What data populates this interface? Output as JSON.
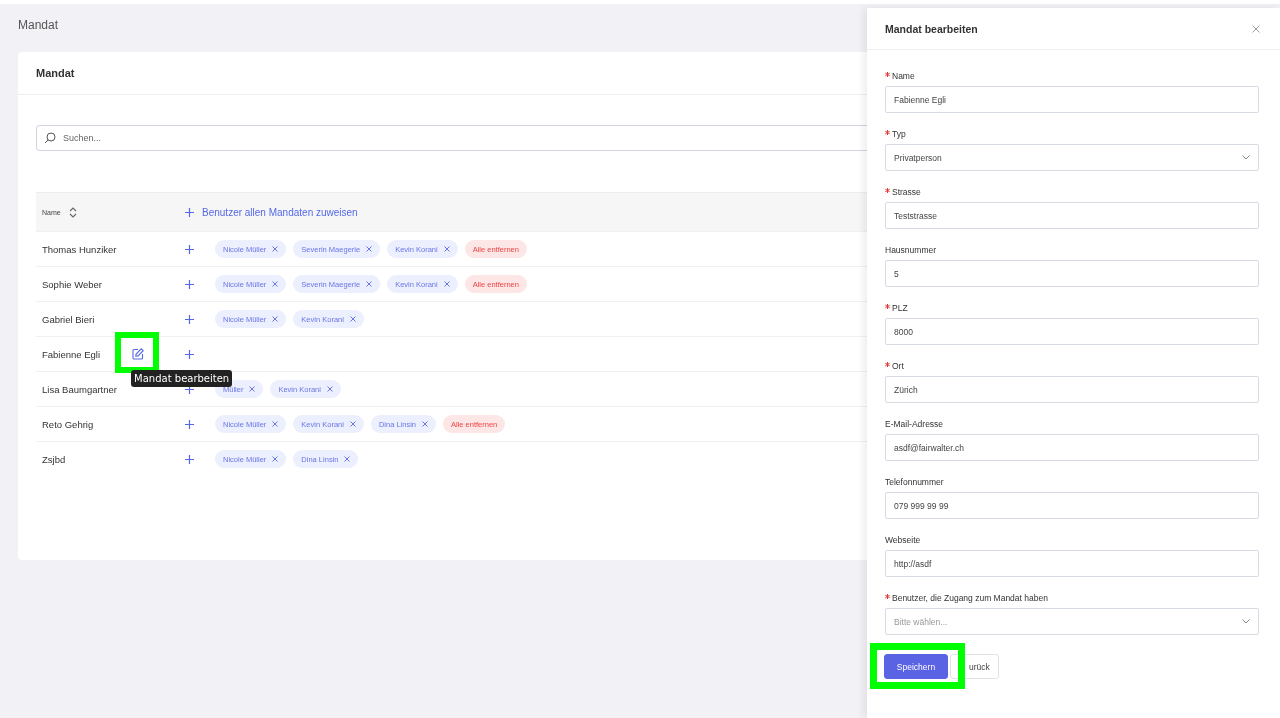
{
  "page": {
    "title": "Mandat"
  },
  "card": {
    "title": "Mandat",
    "search": {
      "placeholder": "Suchen..."
    },
    "table": {
      "columns": [
        {
          "label": "Name",
          "sortable": true
        },
        {
          "label": "Benutzer allen Mandaten zuweisen",
          "kind": "action"
        }
      ],
      "rows": [
        {
          "name": "Thomas Hunziker",
          "hovered": false,
          "users": [
            "Nicole Müller",
            "Severin Maegerle",
            "Kevin Korani"
          ],
          "remove_all": "Alle entfernen"
        },
        {
          "name": "Sophie Weber",
          "hovered": false,
          "users": [
            "Nicole Müller",
            "Severin Maegerle",
            "Kevin Korani"
          ],
          "remove_all": "Alle entfernen"
        },
        {
          "name": "Gabriel Bieri",
          "hovered": false,
          "users": [
            "Nicole Müller",
            "Kevin Korani"
          ]
        },
        {
          "name": "Fabienne Egli",
          "hovered": true,
          "highlight": true,
          "tooltip": "Mandat bearbeiten"
        },
        {
          "name": "Lisa Baumgartner",
          "hovered": false,
          "users": [
            "Müller",
            "Kevin Korani"
          ]
        },
        {
          "name": "Reto Gehrig",
          "hovered": false,
          "users": [
            "Nicole Müller",
            "Kevin Korani",
            "Dina Linsin"
          ],
          "remove_all": "Alle entfernen"
        },
        {
          "name": "Zsjbd",
          "hovered": false,
          "users": [
            "Nicole Müller",
            "Dina Linsin"
          ]
        }
      ]
    }
  },
  "drawer": {
    "title": "Mandat bearbeiten",
    "fields": [
      {
        "label": "Name",
        "required": true,
        "kind": "text",
        "value": "Fabienne Egli"
      },
      {
        "label": "Typ",
        "required": true,
        "kind": "select",
        "value": "Privatperson"
      },
      {
        "label": "Strasse",
        "required": true,
        "kind": "text",
        "value": "Teststrasse"
      },
      {
        "label": "Hausnummer",
        "required": false,
        "kind": "text",
        "value": "5"
      },
      {
        "label": "PLZ",
        "required": true,
        "kind": "text",
        "value": "8000"
      },
      {
        "label": "Ort",
        "required": true,
        "kind": "text",
        "value": "Zürich"
      },
      {
        "label": "E-Mail-Adresse",
        "required": false,
        "kind": "text",
        "value": "asdf@fairwalter.ch"
      },
      {
        "label": "Telefonnummer",
        "required": false,
        "kind": "text",
        "value": "079 999 99 99"
      },
      {
        "label": "Webseite",
        "required": false,
        "kind": "text",
        "value": "http://asdf"
      },
      {
        "label": "Benutzer, die Zugang zum Mandat haben",
        "required": true,
        "kind": "multiselect",
        "placeholder": "Bitte wählen..."
      }
    ],
    "buttons": [
      {
        "label": "Speichern",
        "kind": "primary",
        "highlight": true
      },
      {
        "label": "urück",
        "kind": "default",
        "highlight": false
      }
    ]
  }
}
